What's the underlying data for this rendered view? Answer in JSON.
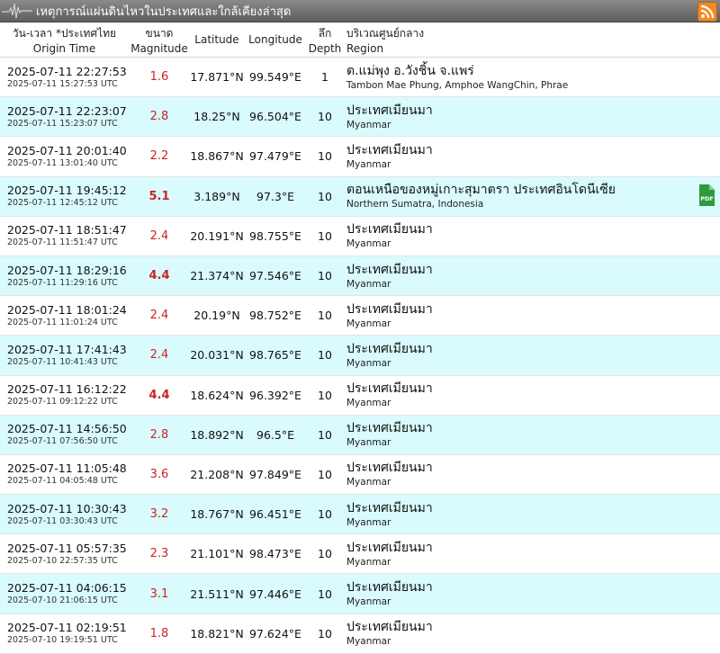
{
  "titlebar": {
    "title": "เหตุการณ์แผ่นดินไหวในประเทศและใกล้เคียงล่าสุด",
    "icons": [
      "seismic-wave-icon",
      "rss-icon"
    ]
  },
  "columns": {
    "time_th": "วัน-เวลา *ประเทศไทย",
    "time_en": "Origin Time",
    "mag_th": "ขนาด",
    "mag_en": "Magnitude",
    "lat": "Latitude",
    "lon": "Longitude",
    "depth_th": "ลึก",
    "depth_en": "Depth",
    "region_th": "บริเวณศูนย์กลาง",
    "region_en": "Region"
  },
  "colors": {
    "row_alt": "#d9fbfd",
    "magnitude": "#cc2222",
    "pdf": "#2e9a3c"
  },
  "rows": [
    {
      "local": "2025-07-11 22:27:53",
      "utc": "2025-07-11 15:27:53 UTC",
      "mag": "1.6",
      "lat": "17.871°N",
      "lon": "99.549°E",
      "depth": "1",
      "region_th": "ต.แม่พุง อ.วังชิ้น จ.แพร่",
      "region_en": "Tambon Mae Phung, Amphoe WangChin, Phrae"
    },
    {
      "local": "2025-07-11 22:23:07",
      "utc": "2025-07-11 15:23:07 UTC",
      "mag": "2.8",
      "lat": "18.25°N",
      "lon": "96.504°E",
      "depth": "10",
      "region_th": "ประเทศเมียนมา",
      "region_en": "Myanmar"
    },
    {
      "local": "2025-07-11 20:01:40",
      "utc": "2025-07-11 13:01:40 UTC",
      "mag": "2.2",
      "lat": "18.867°N",
      "lon": "97.479°E",
      "depth": "10",
      "region_th": "ประเทศเมียนมา",
      "region_en": "Myanmar"
    },
    {
      "local": "2025-07-11 19:45:12",
      "utc": "2025-07-11 12:45:12 UTC",
      "mag": "5.1",
      "lat": "3.189°N",
      "lon": "97.3°E",
      "depth": "10",
      "region_th": "ตอนเหนือของหมู่เกาะสุมาตรา ประเทศอินโดนีเซีย",
      "region_en": "Northern Sumatra, Indonesia",
      "pdf_label": "PDF"
    },
    {
      "local": "2025-07-11 18:51:47",
      "utc": "2025-07-11 11:51:47 UTC",
      "mag": "2.4",
      "lat": "20.191°N",
      "lon": "98.755°E",
      "depth": "10",
      "region_th": "ประเทศเมียนมา",
      "region_en": "Myanmar"
    },
    {
      "local": "2025-07-11 18:29:16",
      "utc": "2025-07-11 11:29:16 UTC",
      "mag": "4.4",
      "lat": "21.374°N",
      "lon": "97.546°E",
      "depth": "10",
      "region_th": "ประเทศเมียนมา",
      "region_en": "Myanmar"
    },
    {
      "local": "2025-07-11 18:01:24",
      "utc": "2025-07-11 11:01:24 UTC",
      "mag": "2.4",
      "lat": "20.19°N",
      "lon": "98.752°E",
      "depth": "10",
      "region_th": "ประเทศเมียนมา",
      "region_en": "Myanmar"
    },
    {
      "local": "2025-07-11 17:41:43",
      "utc": "2025-07-11 10:41:43 UTC",
      "mag": "2.4",
      "lat": "20.031°N",
      "lon": "98.765°E",
      "depth": "10",
      "region_th": "ประเทศเมียนมา",
      "region_en": "Myanmar"
    },
    {
      "local": "2025-07-11 16:12:22",
      "utc": "2025-07-11 09:12:22 UTC",
      "mag": "4.4",
      "lat": "18.624°N",
      "lon": "96.392°E",
      "depth": "10",
      "region_th": "ประเทศเมียนมา",
      "region_en": "Myanmar"
    },
    {
      "local": "2025-07-11 14:56:50",
      "utc": "2025-07-11 07:56:50 UTC",
      "mag": "2.8",
      "lat": "18.892°N",
      "lon": "96.5°E",
      "depth": "10",
      "region_th": "ประเทศเมียนมา",
      "region_en": "Myanmar"
    },
    {
      "local": "2025-07-11 11:05:48",
      "utc": "2025-07-11 04:05:48 UTC",
      "mag": "3.6",
      "lat": "21.208°N",
      "lon": "97.849°E",
      "depth": "10",
      "region_th": "ประเทศเมียนมา",
      "region_en": "Myanmar"
    },
    {
      "local": "2025-07-11 10:30:43",
      "utc": "2025-07-11 03:30:43 UTC",
      "mag": "3.2",
      "lat": "18.767°N",
      "lon": "96.451°E",
      "depth": "10",
      "region_th": "ประเทศเมียนมา",
      "region_en": "Myanmar"
    },
    {
      "local": "2025-07-11 05:57:35",
      "utc": "2025-07-10 22:57:35 UTC",
      "mag": "2.3",
      "lat": "21.101°N",
      "lon": "98.473°E",
      "depth": "10",
      "region_th": "ประเทศเมียนมา",
      "region_en": "Myanmar"
    },
    {
      "local": "2025-07-11 04:06:15",
      "utc": "2025-07-10 21:06:15 UTC",
      "mag": "3.1",
      "lat": "21.511°N",
      "lon": "97.446°E",
      "depth": "10",
      "region_th": "ประเทศเมียนมา",
      "region_en": "Myanmar"
    },
    {
      "local": "2025-07-11 02:19:51",
      "utc": "2025-07-10 19:19:51 UTC",
      "mag": "1.8",
      "lat": "18.821°N",
      "lon": "97.624°E",
      "depth": "10",
      "region_th": "ประเทศเมียนมา",
      "region_en": "Myanmar"
    }
  ]
}
